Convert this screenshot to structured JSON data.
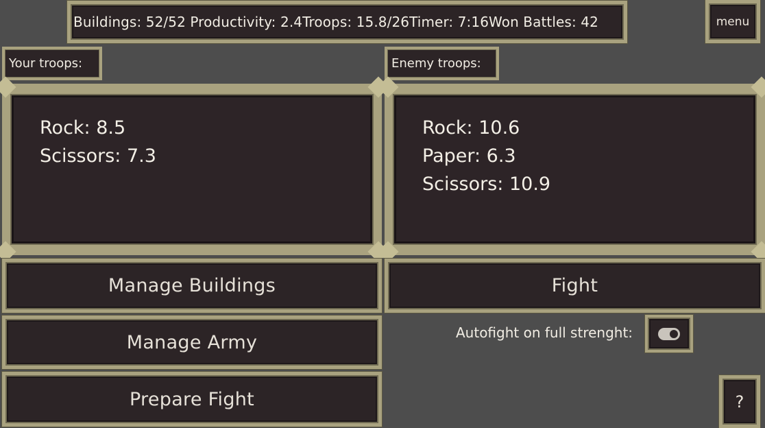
{
  "topbar": {
    "buildings_label": "Buildings:",
    "buildings_value": "52/52",
    "productivity_label": "Productivity:",
    "productivity_value": "2.4",
    "troops_label": "Troops:",
    "troops_value": "15.8/26",
    "timer_label": "Timer:",
    "timer_value": "7:16",
    "won_label": "Won Battles:",
    "won_value": "42"
  },
  "menu_label": "menu",
  "your_troops": {
    "label": "Your troops:",
    "items": [
      "Rock: 8.5",
      "Scissors: 7.3"
    ]
  },
  "enemy_troops": {
    "label": "Enemy troops:",
    "items": [
      "Rock: 10.6",
      "Paper: 6.3",
      "Scissors: 10.9"
    ]
  },
  "buttons": {
    "manage_buildings": "Manage Buildings",
    "manage_army": "Manage Army",
    "prepare_fight": "Prepare Fight",
    "fight": "Fight"
  },
  "autofight": {
    "label": "Autofight on full strenght:",
    "enabled": true
  },
  "help_label": "?",
  "colors": {
    "background": "#4d4d4d",
    "panel": "#2c2426",
    "border": "#a9a27f",
    "text": "#ece6dc"
  }
}
